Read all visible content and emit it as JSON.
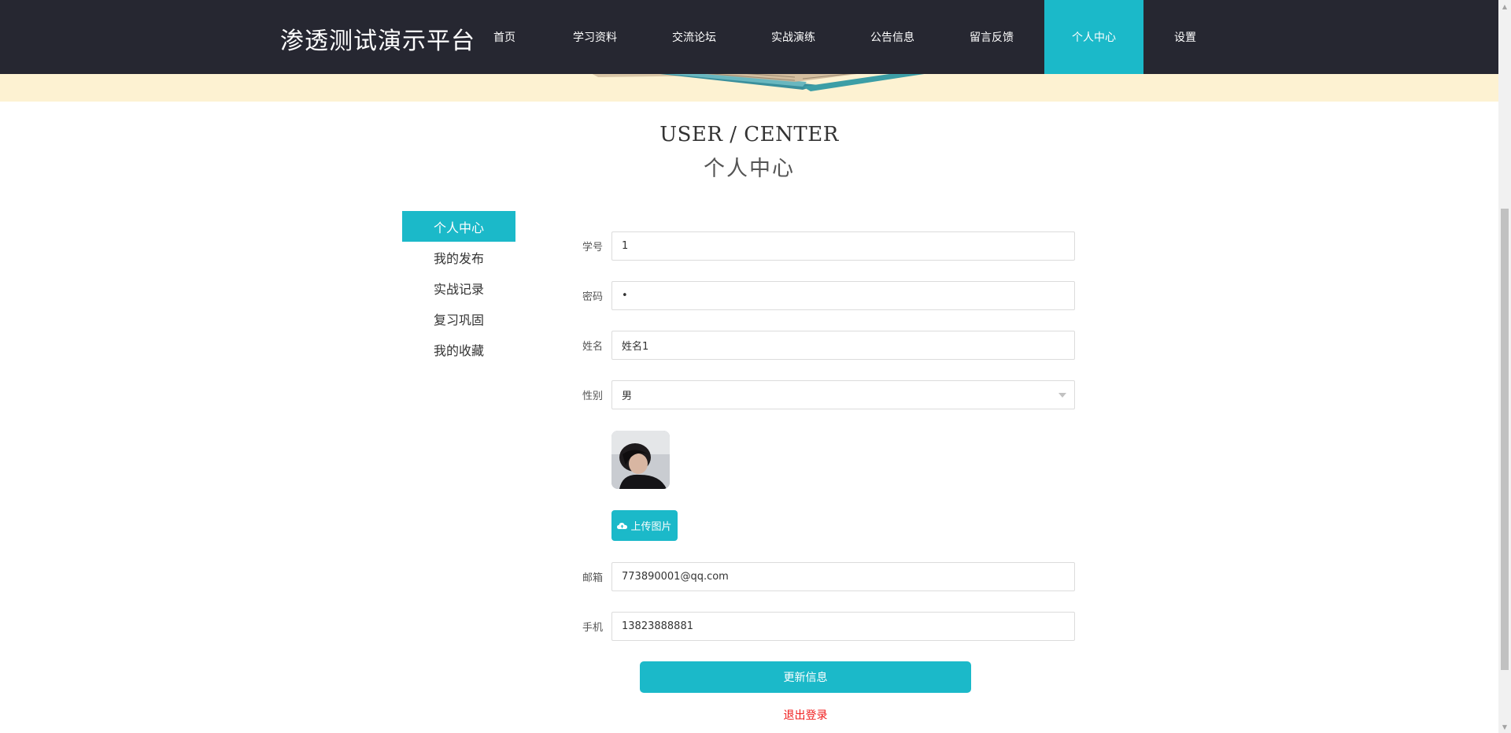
{
  "header": {
    "brand": "渗透测试演示平台",
    "nav": [
      {
        "label": "首页",
        "active": false
      },
      {
        "label": "学习资料",
        "active": false
      },
      {
        "label": "交流论坛",
        "active": false
      },
      {
        "label": "实战演练",
        "active": false
      },
      {
        "label": "公告信息",
        "active": false
      },
      {
        "label": "留言反馈",
        "active": false
      },
      {
        "label": "个人中心",
        "active": true
      },
      {
        "label": "设置",
        "active": false
      }
    ]
  },
  "page": {
    "title_en": "USER / CENTER",
    "title_cn": "个人中心"
  },
  "side_menu": {
    "items": [
      {
        "label": "个人中心",
        "active": true
      },
      {
        "label": "我的发布",
        "active": false
      },
      {
        "label": "实战记录",
        "active": false
      },
      {
        "label": "复习巩固",
        "active": false
      },
      {
        "label": "我的收藏",
        "active": false
      }
    ]
  },
  "form": {
    "student_id": {
      "label": "学号",
      "value": "1"
    },
    "password": {
      "label": "密码",
      "value": "•"
    },
    "name": {
      "label": "姓名",
      "value": "姓名1"
    },
    "gender": {
      "label": "性别",
      "value": "男"
    },
    "upload_label": "上传图片",
    "email": {
      "label": "邮箱",
      "value": "773890001@qq.com"
    },
    "phone": {
      "label": "手机",
      "value": "13823888881"
    },
    "submit_label": "更新信息",
    "logout_label": "退出登录"
  },
  "colors": {
    "header_bg": "#262731",
    "accent": "#1bb9c9",
    "banner_bg": "#fdf2d2",
    "logout": "#f01c1c"
  }
}
